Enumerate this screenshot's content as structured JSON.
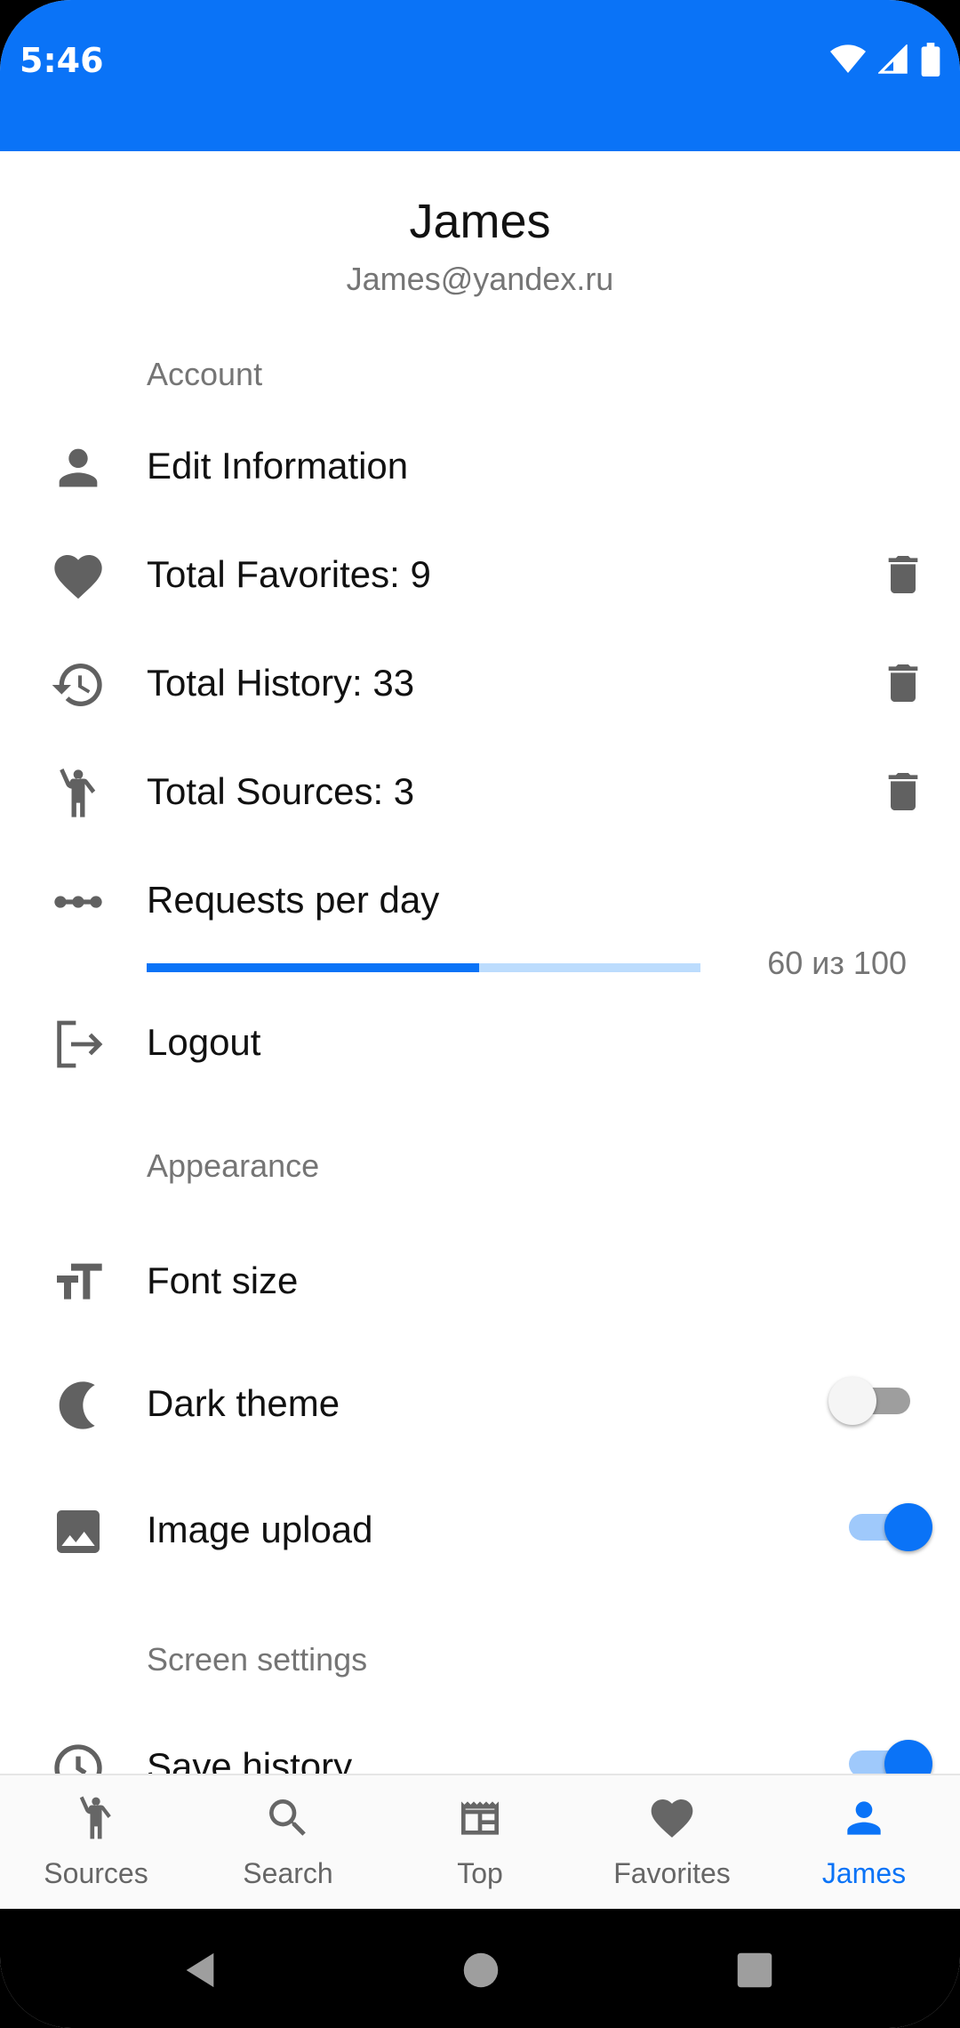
{
  "status": {
    "time": "5:46"
  },
  "profile": {
    "name": "James",
    "email": "James@yandex.ru"
  },
  "sections": {
    "account": "Account",
    "appearance": "Appearance",
    "screen": "Screen settings"
  },
  "account_items": {
    "edit": "Edit Information",
    "favorites": "Total Favorites: 9",
    "history": "Total History: 33",
    "sources": "Total Sources: 3",
    "requests": "Requests per day",
    "requests_text": "60 из 100",
    "requests_used": 60,
    "requests_max": 100,
    "logout": "Logout"
  },
  "appearance_items": {
    "font_size": "Font size",
    "dark_theme": "Dark theme",
    "dark_theme_on": false,
    "image_upload": "Image upload",
    "image_upload_on": true
  },
  "screen_items": {
    "save_history": "Save history",
    "save_history_on": true
  },
  "bottom_nav": {
    "sources": "Sources",
    "search": "Search",
    "top": "Top",
    "favorites": "Favorites",
    "profile": "James",
    "active": "profile"
  },
  "colors": {
    "accent": "#0a73f7",
    "icon": "#616161",
    "muted": "#757575"
  }
}
